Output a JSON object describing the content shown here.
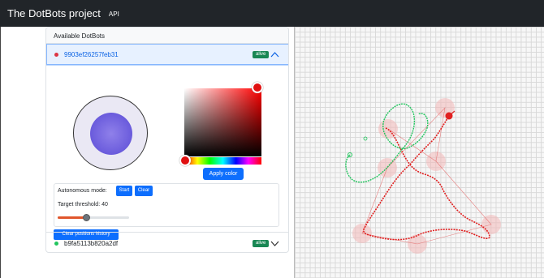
{
  "navbar": {
    "brand": "The DotBots project",
    "api_link": "API"
  },
  "panel": {
    "title": "Available DotBots"
  },
  "bots": [
    {
      "id": "9903ef26257feb31",
      "status": "alive",
      "expanded": true,
      "color": "#dc3545"
    },
    {
      "id": "b9fa5113b820a2df",
      "status": "alive",
      "expanded": false,
      "color": "#22c55e"
    }
  ],
  "controls": {
    "apply_color_label": "Apply color",
    "autonomous_mode_label": "Autonomous mode:",
    "start_label": "Start",
    "clear_label": "Clear",
    "target_threshold_label": "Target threshold: 40",
    "threshold_value": 40,
    "clear_history_label": "Clear positions history",
    "selected_color": "#ff0000"
  },
  "icons": {
    "expanded": "chevron-up-icon",
    "collapsed": "chevron-down-icon",
    "status_dot": "circle-icon"
  },
  "map": {
    "grid": true,
    "trajectory_colors": {
      "bot1": "#e02020",
      "bot2": "#22c55e"
    }
  }
}
